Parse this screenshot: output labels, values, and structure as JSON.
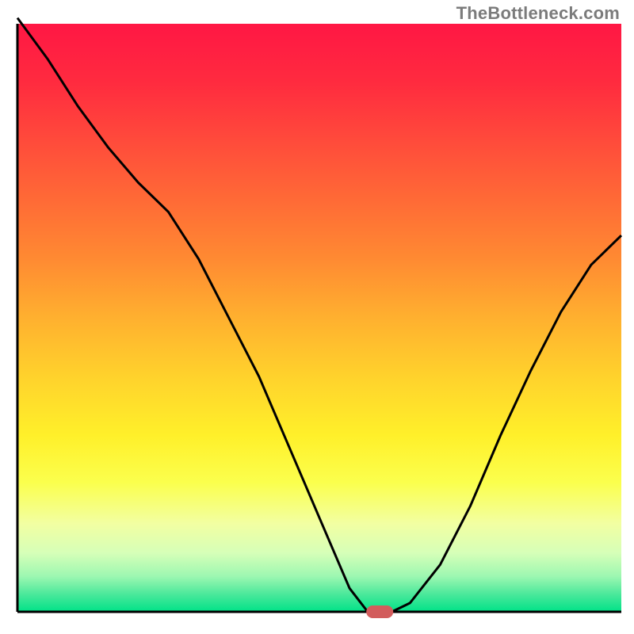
{
  "watermark": "TheBottleneck.com",
  "chart_data": {
    "type": "line",
    "title": "",
    "xlabel": "",
    "ylabel": "",
    "xlim": [
      0,
      100
    ],
    "ylim": [
      0,
      100
    ],
    "grid": false,
    "x": [
      0,
      5,
      10,
      15,
      20,
      25,
      30,
      35,
      40,
      45,
      50,
      55,
      58,
      62,
      65,
      70,
      75,
      80,
      85,
      90,
      95,
      100
    ],
    "values": [
      101,
      94,
      86,
      79,
      73,
      68,
      60,
      50,
      40,
      28,
      16,
      4,
      0,
      0,
      1.5,
      8,
      18,
      30,
      41,
      51,
      59,
      64
    ],
    "background": {
      "type": "vertical_gradient",
      "stops": [
        {
          "pos": 0.0,
          "color": "#ff1744"
        },
        {
          "pos": 0.1,
          "color": "#ff2b3f"
        },
        {
          "pos": 0.2,
          "color": "#ff4b3b"
        },
        {
          "pos": 0.3,
          "color": "#ff6a36"
        },
        {
          "pos": 0.4,
          "color": "#ff8a32"
        },
        {
          "pos": 0.5,
          "color": "#ffb02f"
        },
        {
          "pos": 0.6,
          "color": "#ffd22c"
        },
        {
          "pos": 0.7,
          "color": "#fff02a"
        },
        {
          "pos": 0.78,
          "color": "#fbff4d"
        },
        {
          "pos": 0.85,
          "color": "#f2ffa2"
        },
        {
          "pos": 0.9,
          "color": "#d6ffb8"
        },
        {
          "pos": 0.94,
          "color": "#9cf7b1"
        },
        {
          "pos": 0.97,
          "color": "#4be89b"
        },
        {
          "pos": 1.0,
          "color": "#00e288"
        }
      ]
    },
    "marker": {
      "x": 60,
      "y": 0,
      "color": "#d25c5c"
    },
    "axes": {
      "show": true,
      "color": "#000000"
    }
  }
}
